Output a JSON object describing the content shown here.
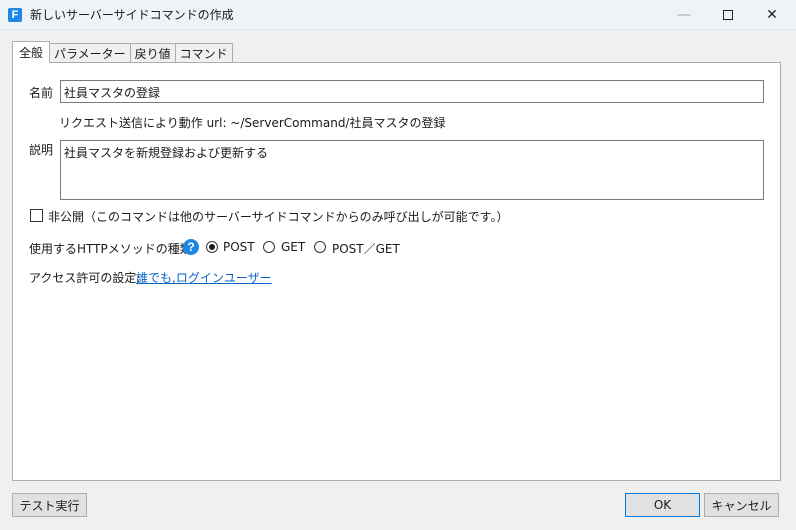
{
  "window": {
    "title": "新しいサーバーサイドコマンドの作成",
    "app_icon_letter": "F",
    "minimize_glyph": "—",
    "close_glyph": "✕"
  },
  "tabs": [
    {
      "label": "全般",
      "active": true
    },
    {
      "label": "パラメーター",
      "active": false
    },
    {
      "label": "戻り値",
      "active": false
    },
    {
      "label": "コマンド",
      "active": false
    }
  ],
  "form": {
    "name_label": "名前",
    "name_value": "社員マスタの登録",
    "url_text": "リクエスト送信により動作 url: ~/ServerCommand/社員マスタの登録",
    "description_label": "説明",
    "description_value": "社員マスタを新規登録および更新する",
    "private_checkbox_label": "非公開（このコマンドは他のサーバーサイドコマンドからのみ呼び出しが可能です。）",
    "private_checked": false,
    "http_method_label": "使用するHTTPメソッドの種類:",
    "help_glyph": "?",
    "http_methods": [
      {
        "label": "POST",
        "checked": true
      },
      {
        "label": "GET",
        "checked": false
      },
      {
        "label": "POST／GET",
        "checked": false
      }
    ],
    "access_label": "アクセス許可の設定:",
    "access_link": "誰でも,ログインユーザー"
  },
  "footer": {
    "test_run_label": "テスト実行",
    "ok_label": "OK",
    "cancel_label": "キャンセル"
  },
  "colors": {
    "accent": "#1e88e5",
    "link": "#0a64c8",
    "default_button_border": "#0078d7"
  }
}
